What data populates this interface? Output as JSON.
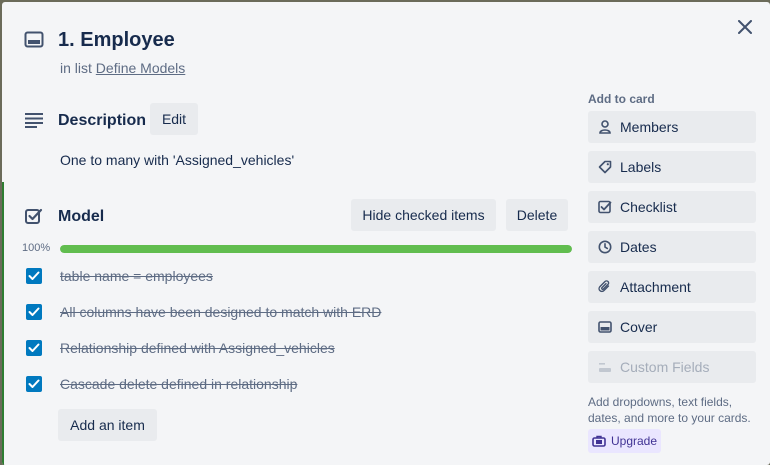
{
  "card": {
    "title": "1. Employee",
    "in_list_prefix": "in list",
    "list_name": "Define Models"
  },
  "description": {
    "heading": "Description",
    "edit_label": "Edit",
    "text": "One to many with 'Assigned_vehicles'"
  },
  "checklist": {
    "heading": "Model",
    "hide_checked_label": "Hide checked items",
    "delete_label": "Delete",
    "progress_percent": 100,
    "progress_label": "100%",
    "items": [
      {
        "label": "table name = employees",
        "checked": true
      },
      {
        "label": "All columns have been designed to match with ERD",
        "checked": true
      },
      {
        "label": "Relationship defined with Assigned_vehicles",
        "checked": true
      },
      {
        "label": "Cascade delete defined in relationship",
        "checked": true
      }
    ],
    "add_item_label": "Add an item"
  },
  "sidebar": {
    "heading": "Add to card",
    "buttons": [
      {
        "label": "Members",
        "icon": "person-icon"
      },
      {
        "label": "Labels",
        "icon": "tag-icon"
      },
      {
        "label": "Checklist",
        "icon": "checkbox-icon"
      },
      {
        "label": "Dates",
        "icon": "clock-icon"
      },
      {
        "label": "Attachment",
        "icon": "paperclip-icon"
      },
      {
        "label": "Cover",
        "icon": "cover-icon"
      },
      {
        "label": "Custom Fields",
        "icon": "custom-fields-icon",
        "disabled": true
      }
    ],
    "note": "Add dropdowns, text fields, dates, and more to your cards.",
    "upgrade_label": "Upgrade"
  },
  "colors": {
    "accent": "#0079bf",
    "progress": "#61bd4f",
    "upgrade_bg": "#eae6ff",
    "upgrade_text": "#403294"
  }
}
